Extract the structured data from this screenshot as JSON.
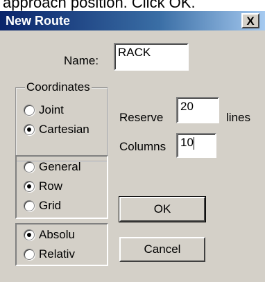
{
  "caption": "approach position. Click OK.",
  "dialog": {
    "title": "New Route",
    "close_symbol": "X",
    "name_label": "Name:",
    "name_value": "RACK",
    "coordinates": {
      "legend": "Coordinates",
      "options": [
        {
          "label": "Joint",
          "checked": false
        },
        {
          "label": "Cartesian",
          "checked": true
        }
      ]
    },
    "reserve_label": "Reserve",
    "reserve_value": "20",
    "lines_label": "lines",
    "columns_label": "Columns",
    "columns_value": "10",
    "type_group": {
      "options": [
        {
          "label": "General",
          "checked": false
        },
        {
          "label": "Row",
          "checked": true
        },
        {
          "label": "Grid",
          "checked": false
        }
      ]
    },
    "mode_group": {
      "options": [
        {
          "label": "Absolu",
          "checked": true
        },
        {
          "label": "Relativ",
          "checked": false
        }
      ]
    },
    "ok_label": "OK",
    "cancel_label": "Cancel"
  }
}
